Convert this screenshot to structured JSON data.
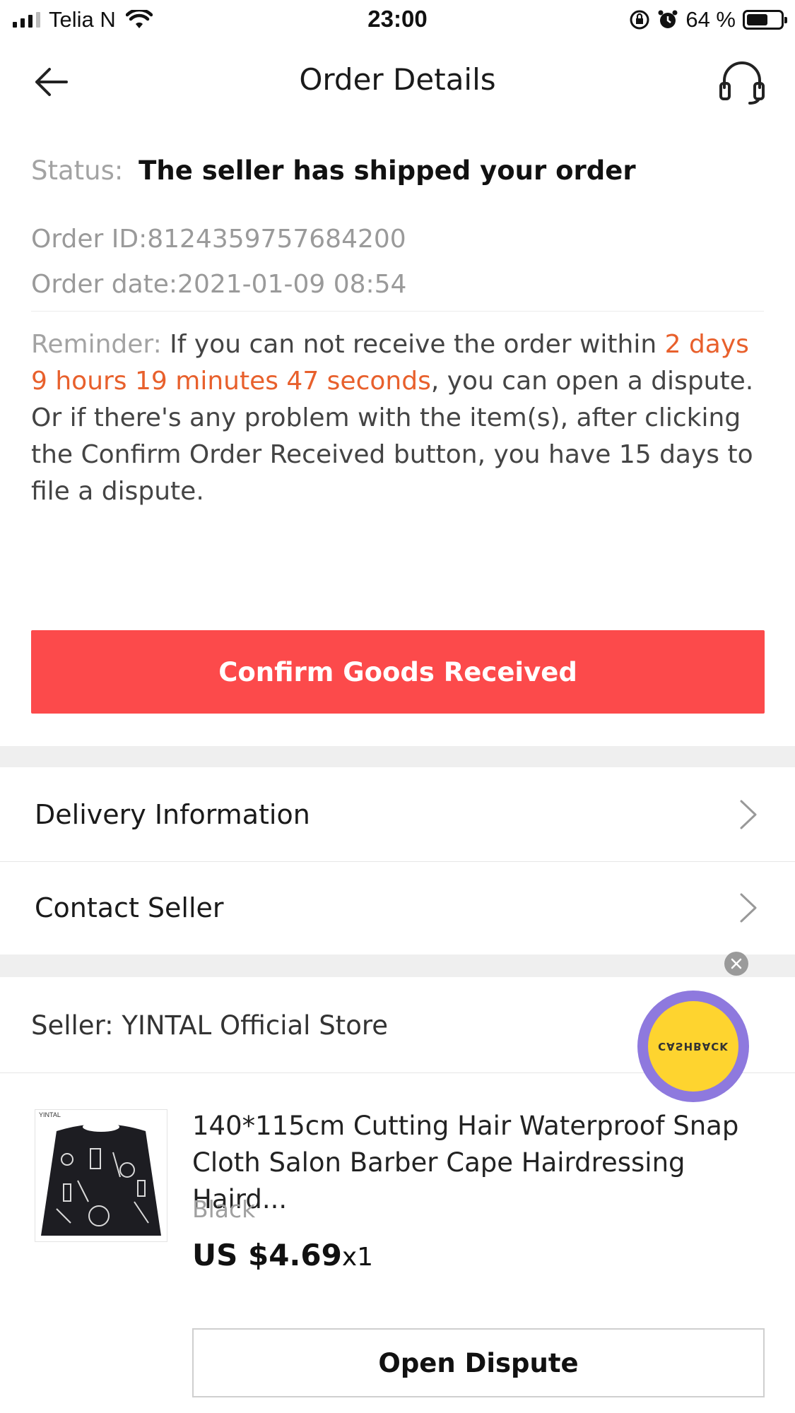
{
  "status_bar": {
    "carrier": "Telia N",
    "time": "23:00",
    "battery_text": "64 %",
    "battery_level": 0.64
  },
  "header": {
    "title": "Order Details",
    "back_icon": "arrow-left-icon",
    "support_icon": "headset-icon"
  },
  "order": {
    "status_label": "Status:",
    "status_value": "The seller has shipped your order",
    "order_id_text": "Order ID:8124359757684200",
    "order_date_text": "Order date:2021-01-09 08:54",
    "reminder_label": "Reminder: ",
    "reminder_before": "If you can not receive the order within ",
    "reminder_countdown": "2 days 9 hours 19 minutes 47 seconds",
    "reminder_after": ", you can open a dispute. Or if there's any problem with the item(s), after clicking the Confirm Order Received button, you have 15 days to file a dispute."
  },
  "actions": {
    "confirm_label": "Confirm Goods Received",
    "open_dispute_label": "Open Dispute"
  },
  "menu": [
    {
      "label": "Delivery Information"
    },
    {
      "label": "Contact Seller"
    }
  ],
  "seller": {
    "label": "Seller: YINTAL Official Store"
  },
  "promo": {
    "cashback_text": "CASHBACK"
  },
  "product": {
    "brand_mark": "YINTAL",
    "title": "140*115cm Cutting Hair Waterproof Snap Cloth Salon Barber Cape Hairdressing Haird...",
    "variant": "Black",
    "price": "US $4.69",
    "quantity": "x1"
  },
  "colors": {
    "accent_red": "#fc4a4b",
    "countdown_orange": "#e8602c",
    "cashback_purple": "#8e79de",
    "cashback_yellow": "#fed42f"
  }
}
